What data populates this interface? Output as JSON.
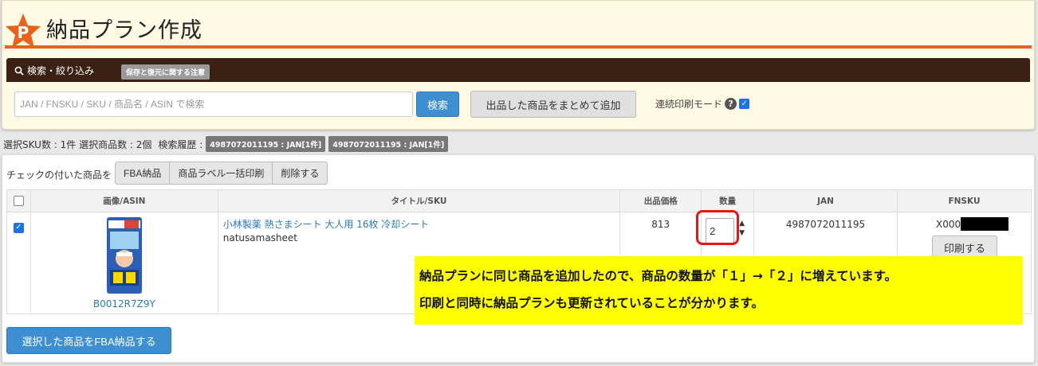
{
  "page": {
    "title": "納品プラン作成",
    "logo_letter": "P",
    "accent_color": "#e8621a",
    "header_bar_color": "#3b2112"
  },
  "search": {
    "section_title": "検索・絞り込み",
    "notice_badge": "保存と復元に関する注意",
    "placeholder": "JAN / FNSKU / SKU / 商品名 / ASIN で検索",
    "search_button": "検索",
    "add_listed_button": "出品した商品をまとめて追加",
    "print_mode_label": "連続印刷モード",
    "print_mode_checked": true
  },
  "status": {
    "summary": "選択SKU数 : 1件 選択商品数 : 2個",
    "history_label": "検索履歴 :",
    "history": [
      "4987072011195 : JAN[1件]",
      "4987072011195 : JAN[1件]"
    ]
  },
  "actions": {
    "checked_label": "チェックの付いた商品を",
    "buttons": [
      "FBA納品",
      "商品ラベル一括印刷",
      "削除する"
    ]
  },
  "table": {
    "headers": {
      "image": "画像/ASIN",
      "title": "タイトル/SKU",
      "price": "出品価格",
      "qty": "数量",
      "jan": "JAN",
      "fnsku": "FNSKU"
    },
    "rows": [
      {
        "checked": true,
        "asin": "B0012R7Z9Y",
        "title": "小林製薬 熱さまシート 大人用 16枚 冷却シート",
        "sku": "natusamasheet",
        "price": "813",
        "qty": "2",
        "jan": "4987072011195",
        "fnsku_visible": "X000",
        "print_button": "印刷する"
      }
    ]
  },
  "footer": {
    "fba_button": "選択した商品をFBA納品する"
  },
  "annotation": {
    "line1": "納品プランに同じ商品を追加したので、商品の数量が「１」→「２」に増えています。",
    "line2": "印刷と同時に納品プランも更新されていることが分かります。"
  }
}
